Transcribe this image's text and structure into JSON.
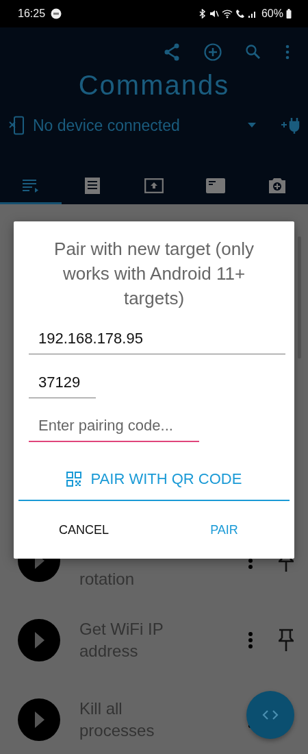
{
  "status_bar": {
    "time": "16:25",
    "battery": "60%"
  },
  "app_bar": {
    "title": "Commands",
    "device": "No device connected"
  },
  "tabs": [
    {
      "kind": "commands",
      "selected": true
    },
    {
      "kind": "log",
      "selected": false
    },
    {
      "kind": "upload",
      "selected": false
    },
    {
      "kind": "window",
      "selected": false
    },
    {
      "kind": "camera",
      "selected": false
    }
  ],
  "commands": [
    {
      "title": "rotation"
    },
    {
      "title": "Get WiFi IP address"
    },
    {
      "title": "Kill all processes"
    }
  ],
  "dialog": {
    "title": "Pair with new target (only works with Android 11+ targets)",
    "fields": [
      {
        "value": "192.168.178.95",
        "focused": false
      },
      {
        "value": "37129",
        "focused": false
      },
      {
        "placeholder": "Enter pairing code...",
        "focused": true
      }
    ],
    "qr_button": "PAIR WITH QR CODE",
    "buttons": [
      {
        "label": "CANCEL",
        "kind": "neutral"
      },
      {
        "label": "PAIR",
        "kind": "primary"
      }
    ]
  }
}
